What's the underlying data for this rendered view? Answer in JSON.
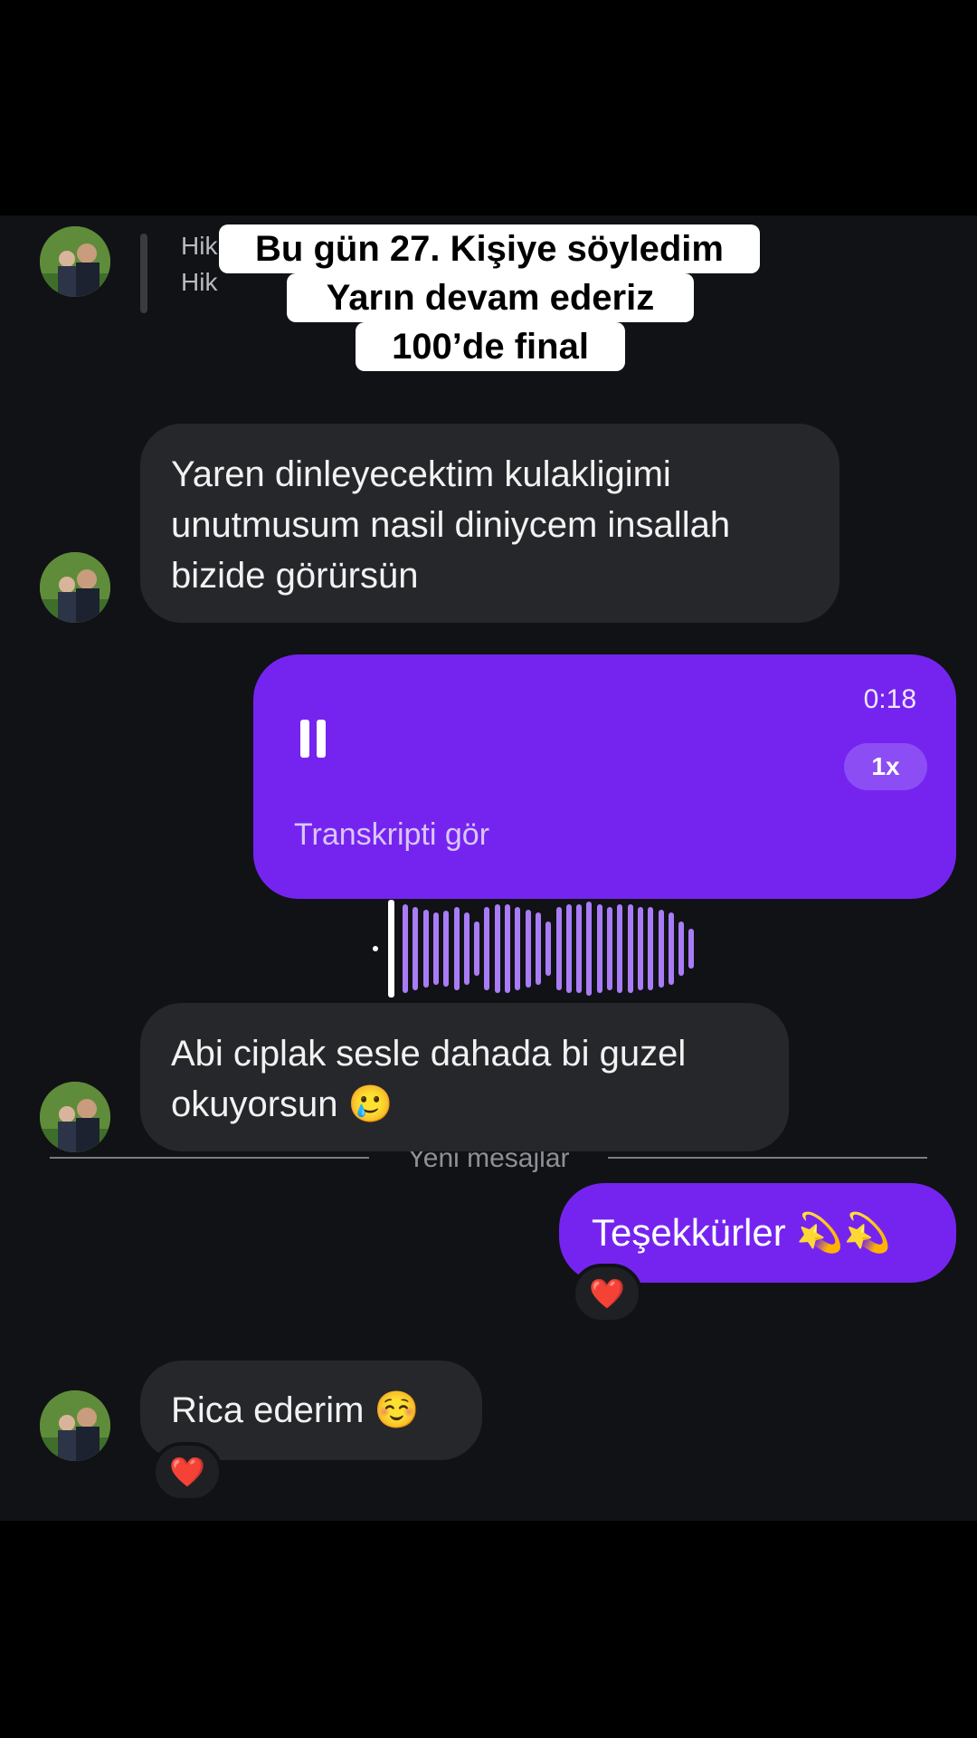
{
  "overlay_caption": {
    "line1": "Bu gün 27. Kişiye söyledim",
    "line2": "Yarın devam ederiz",
    "line3": "100’de final"
  },
  "story_reply": {
    "line1": "Hik",
    "line2": "Hik"
  },
  "messages": {
    "m1": {
      "line1": "Yaren dinleyecektim kulakligimi",
      "line2": "unutmusum nasil diniycem insallah",
      "line3": "bizide görürsün"
    },
    "voice": {
      "duration": "0:18",
      "speed": "1x",
      "transcript_link": "Transkripti gör",
      "pause_icon": "pause-icon",
      "progress": 0.0
    },
    "divider": "Yeni mesajlar",
    "m2": {
      "line1": "Abi ciplak sesle dahada bi guzel",
      "line2": "okuyorsun 🥲"
    },
    "m3": {
      "text": "Teşekkürler 💫💫",
      "reaction": "❤️"
    },
    "m4": {
      "text": "Rica ederim ☺️",
      "reaction": "❤️"
    }
  },
  "colors": {
    "outgoing_bubble": "#7524f0",
    "incoming_bubble": "#26272b",
    "background": "#111215"
  }
}
